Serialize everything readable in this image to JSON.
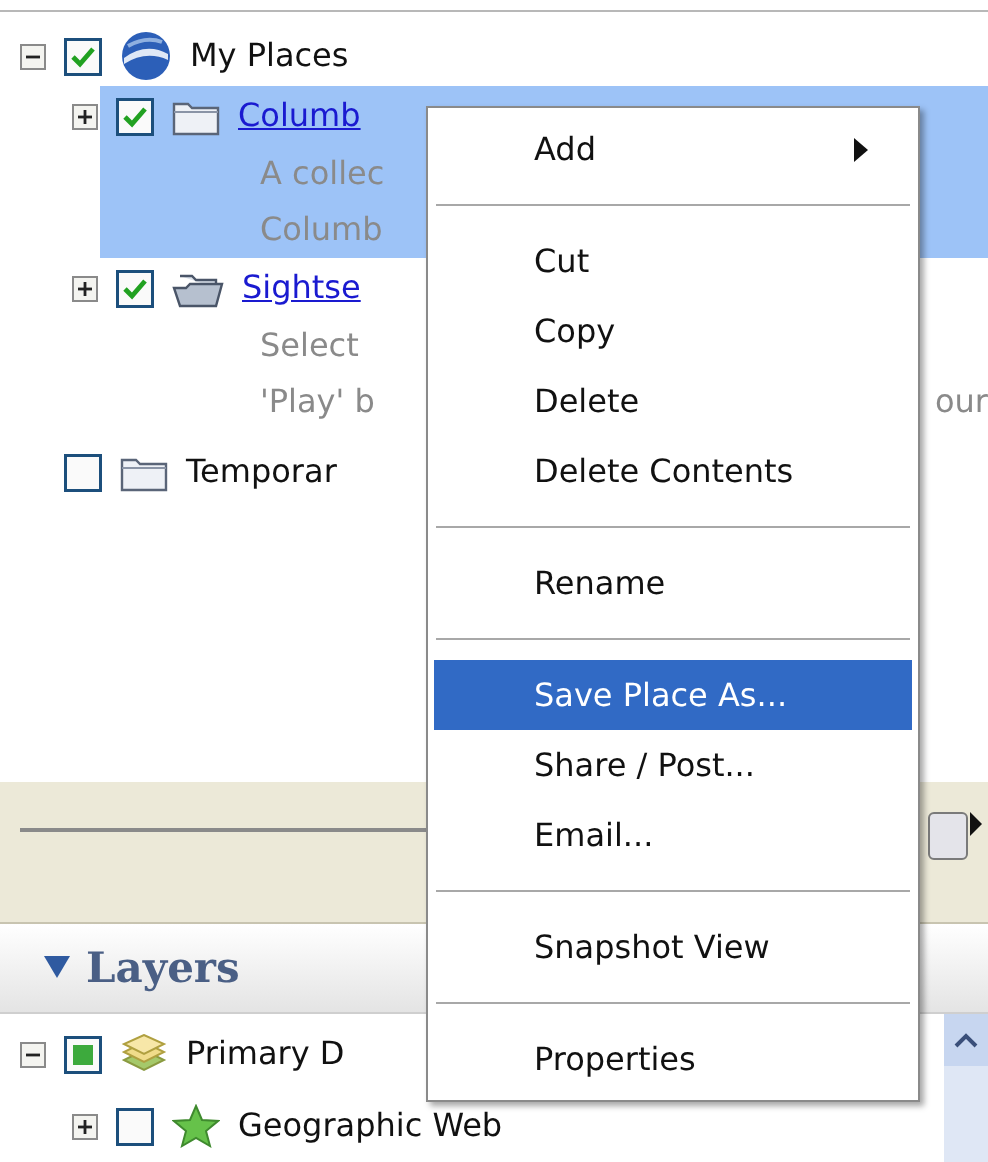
{
  "places_tree": [
    {
      "label": "My Places",
      "kind": "globe",
      "checked": true,
      "expanded": true,
      "selected": false,
      "link": false,
      "children": [
        {
          "label": "Columb",
          "kind": "folder",
          "checked": true,
          "expanded": false,
          "selected": true,
          "link": true,
          "description": [
            {
              "text": "A collec"
            },
            {
              "text": "Columb"
            }
          ]
        },
        {
          "label": "Sightse",
          "kind": "open-folder",
          "checked": true,
          "expanded": false,
          "selected": false,
          "link": true,
          "description": [
            {
              "text": "Select"
            },
            {
              "text": "'Play' b",
              "continuation": "our"
            }
          ]
        }
      ]
    },
    {
      "label": "Temporar",
      "kind": "folder",
      "checked": false,
      "selected": false,
      "link": false
    }
  ],
  "context_menu": {
    "items": [
      {
        "kind": "item",
        "label": "Add",
        "submenu": true,
        "selected": false
      },
      {
        "kind": "separator"
      },
      {
        "kind": "item",
        "label": "Cut",
        "submenu": false,
        "selected": false
      },
      {
        "kind": "item",
        "label": "Copy",
        "submenu": false,
        "selected": false
      },
      {
        "kind": "item",
        "label": "Delete",
        "submenu": false,
        "selected": false
      },
      {
        "kind": "item",
        "label": "Delete Contents",
        "submenu": false,
        "selected": false
      },
      {
        "kind": "separator"
      },
      {
        "kind": "item",
        "label": "Rename",
        "submenu": false,
        "selected": false
      },
      {
        "kind": "separator"
      },
      {
        "kind": "item",
        "label": "Save Place As...",
        "submenu": false,
        "selected": true
      },
      {
        "kind": "item",
        "label": "Share / Post...",
        "submenu": false,
        "selected": false
      },
      {
        "kind": "item",
        "label": "Email...",
        "submenu": false,
        "selected": false
      },
      {
        "kind": "separator"
      },
      {
        "kind": "item",
        "label": "Snapshot View",
        "submenu": false,
        "selected": false
      },
      {
        "kind": "separator"
      },
      {
        "kind": "item",
        "label": "Properties",
        "submenu": false,
        "selected": false
      }
    ]
  },
  "layers_panel": {
    "title": "Layers",
    "expanded": true,
    "items": [
      {
        "label": "Primary D",
        "kind": "layers",
        "mixed": true,
        "expanded": true
      },
      {
        "label": "Geographic Web",
        "kind": "star",
        "checked": false,
        "mixed": false,
        "expanded": false
      }
    ]
  }
}
